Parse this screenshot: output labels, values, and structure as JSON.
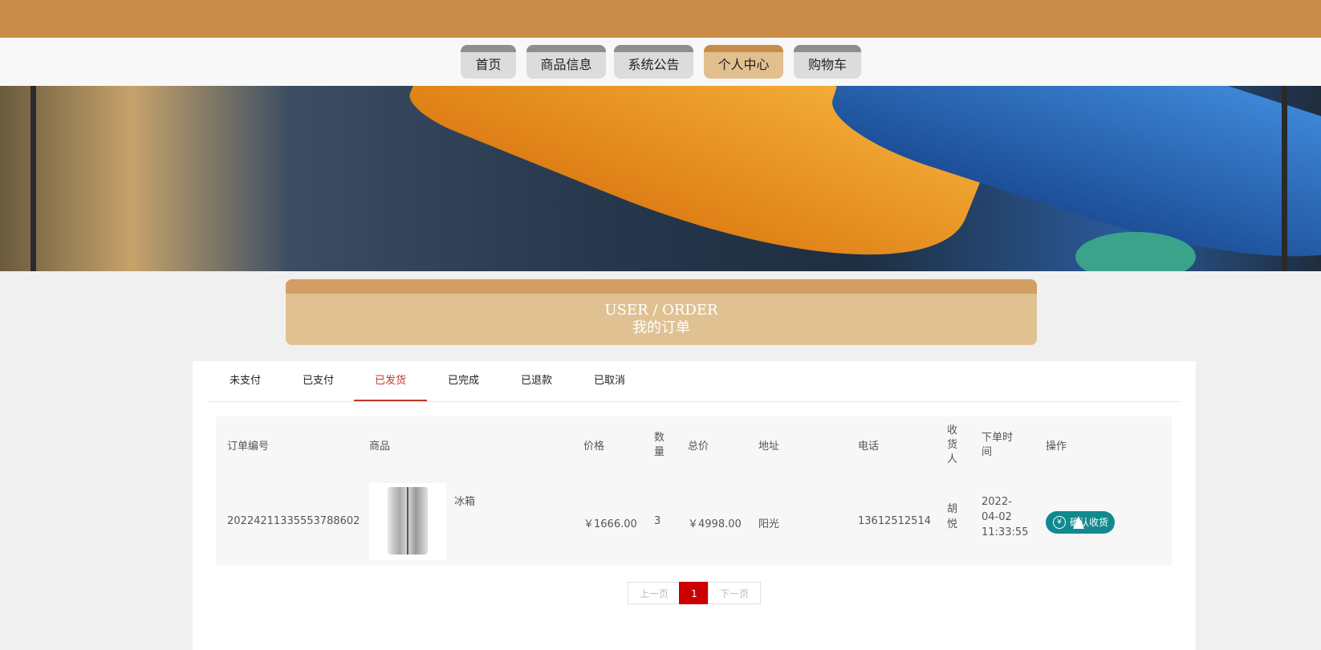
{
  "nav": {
    "items": [
      {
        "label": "首页"
      },
      {
        "label": "商品信息"
      },
      {
        "label": "系统公告"
      },
      {
        "label": "个人中心"
      },
      {
        "label": "购物车"
      }
    ]
  },
  "header": {
    "en": "USER / ORDER",
    "cn": "我的订单"
  },
  "tabs": [
    "未支付",
    "已支付",
    "已发货",
    "已完成",
    "已退款",
    "已取消"
  ],
  "table": {
    "headers": {
      "order_no": "订单编号",
      "product": "商品",
      "price": "价格",
      "qty": "数\n量",
      "total": "总价",
      "address": "地址",
      "phone": "电话",
      "receiver": "收\n货\n人",
      "time": "下单时\n间",
      "action": "操作"
    },
    "rows": [
      {
        "order_no": "20224211335553788602",
        "product": "冰箱",
        "price": "￥1666.00",
        "qty": "3",
        "total": "￥4998.00",
        "address": "阳光",
        "phone": "13612512514",
        "receiver": "胡\n悦",
        "time": "2022-\n04-02\n11:33:55",
        "action": "确认收货",
        "action_icon": "yen-icon"
      }
    ]
  },
  "pagination": {
    "prev": "上一页",
    "current": "1",
    "next": "下一页"
  },
  "colors": {
    "accent": "#c98c48",
    "active_tab": "#c0392b",
    "action": "#12898f",
    "page_current": "#cc0000"
  }
}
